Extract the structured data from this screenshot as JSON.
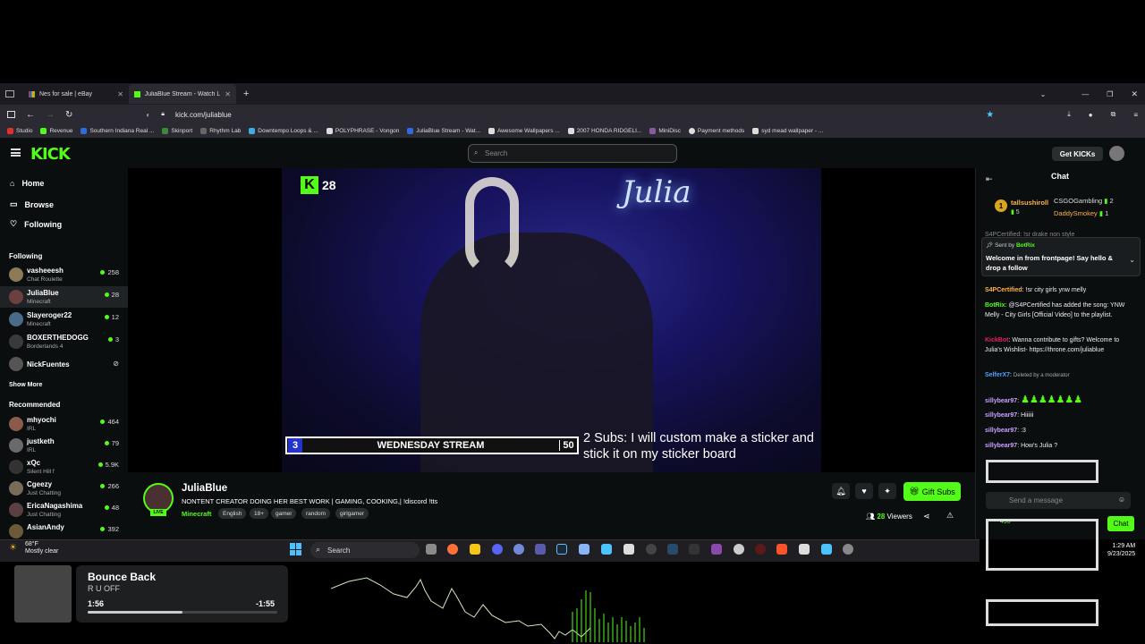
{
  "browser": {
    "tabs": [
      {
        "label": "Nes for sale | eBay",
        "active": false
      },
      {
        "label": "JuliaBlue Stream - Watch Live o",
        "active": true
      }
    ],
    "url": "kick.com/juliablue",
    "bookmarks": [
      "Studio",
      "Revenue",
      "Southern Indiana Real ...",
      "Skinport",
      "Rhythm Lab",
      "Downtempo Loops & ...",
      "POLYPHRASE - Vongon",
      "JuliaBlue Stream - Wat...",
      "Awesome Wallpapers ...",
      "2007 HONDA RIDGELI...",
      "MiniDisc",
      "Payment methods",
      "syd mead wallpaper - ..."
    ]
  },
  "header": {
    "search_placeholder": "Search",
    "get_kicks": "Get KICKs"
  },
  "nav": {
    "home": "Home",
    "browse": "Browse",
    "following": "Following"
  },
  "sidebar": {
    "following_title": "Following",
    "following": [
      {
        "name": "vasheeesh",
        "category": "Chat Roulette",
        "viewers": "258",
        "color": "#8a7a55"
      },
      {
        "name": "JuliaBlue",
        "category": "Minecraft",
        "viewers": "28",
        "color": "#6a4040"
      },
      {
        "name": "Slayeroger22",
        "category": "Minecraft",
        "viewers": "12",
        "color": "#4a6a8a"
      },
      {
        "name": "BOXERTHEDOGG",
        "category": "Borderlands 4",
        "viewers": "3",
        "color": "#3a3a3a"
      },
      {
        "name": "NickFuentes",
        "category": "",
        "viewers": "",
        "color": "#555555"
      }
    ],
    "show_more": "Show More",
    "recommended_title": "Recommended",
    "recommended": [
      {
        "name": "mhyochi",
        "category": "IRL",
        "viewers": "464",
        "color": "#8a5a4a"
      },
      {
        "name": "justketh",
        "category": "IRL",
        "viewers": "79",
        "color": "#6a6a6a"
      },
      {
        "name": "xQc",
        "category": "Silent Hill f",
        "viewers": "5.9K",
        "color": "#333333"
      },
      {
        "name": "Cgeezy",
        "category": "Just Chatting",
        "viewers": "266",
        "color": "#7a6a5a"
      },
      {
        "name": "EricaNagashima",
        "category": "Just Chatting",
        "viewers": "48",
        "color": "#5a4040"
      },
      {
        "name": "AsianAndy",
        "category": "",
        "viewers": "392",
        "color": "#6a5a3a"
      }
    ]
  },
  "video": {
    "k_count": "28",
    "goal": {
      "start": "3",
      "label": "WEDNESDAY STREAM",
      "end": "50"
    },
    "goal_text": "2 Subs: I will custom make a sticker and stick it on my sticker board"
  },
  "channel": {
    "name": "JuliaBlue",
    "title": "NONTENT CREATOR DOING HER BEST WORK | GAMING, COOKING,| !discord !tts",
    "category": "Minecraft",
    "tags": [
      "English",
      "18+",
      "gamer",
      "random",
      "girlgamer"
    ],
    "live_label": "LIVE",
    "gift_subs": "Gift Subs",
    "viewers_count": "28",
    "viewers_label": "Viewers"
  },
  "chat": {
    "title": "Chat",
    "top_gifter": {
      "name": "tallsushiroll",
      "count": "5"
    },
    "leaders": [
      {
        "name": "CSGOGambling",
        "count": "2"
      },
      {
        "name": "DaddySmokey",
        "count": "1"
      }
    ],
    "pinned_sender_label": "Sent by",
    "pinned_sender": "BotRix",
    "pinned_text": "Welcome in from frontpage! Say hello & drop a follow",
    "faded_line": "S4PCertified: !sr drake non style",
    "messages": [
      {
        "user": "S4PCertified",
        "text": "!sr city girls ynw melly",
        "color": "#ffb347"
      },
      {
        "user": "BotRix",
        "text": "@S4PCertified has added the song: YNW Melly - City Girls [Official Video] to the playlist.",
        "color": "#53fc18"
      },
      {
        "user": "KickBot",
        "text": "Wanna contribute to gifts? Welcome to Julia's Wishlist- https://throne.com/juliablue",
        "color": "#e0245e"
      },
      {
        "user": "SelferX7",
        "text": "Deleted by a moderator",
        "color": "#4aa3ff"
      },
      {
        "user": "sillybear97",
        "text": "",
        "color": "#c9a0ff"
      },
      {
        "user": "sillybear97",
        "text": "Hiiiiii",
        "color": "#c9a0ff"
      },
      {
        "user": "sillybear97",
        "text": ":3",
        "color": "#c9a0ff"
      },
      {
        "user": "sillybear97",
        "text": "How's Julia ?",
        "color": "#c9a0ff"
      }
    ],
    "send_placeholder": "Send a message",
    "send_button": "Chat",
    "points": "490"
  },
  "taskbar": {
    "temp": "68°F",
    "weather": "Mostly clear",
    "search": "Search",
    "time": "1:29 AM",
    "date": "9/23/2025"
  },
  "music": {
    "title": "Bounce Back",
    "artist": "R U OFF",
    "elapsed": "1:56",
    "remaining": "-1:55",
    "progress": 0.5
  },
  "colors": {
    "kick_green": "#53fc18",
    "bg": "#0b0e0f"
  }
}
